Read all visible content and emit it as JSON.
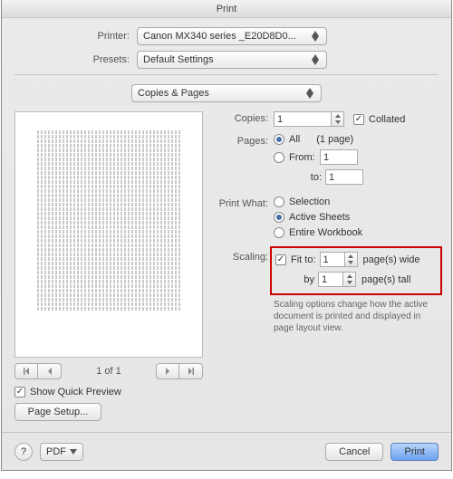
{
  "title": "Print",
  "printer": {
    "label": "Printer:",
    "value": "Canon MX340 series _E20D8D0..."
  },
  "presets": {
    "label": "Presets:",
    "value": "Default Settings"
  },
  "section": "Copies & Pages",
  "copies": {
    "label": "Copies:",
    "value": "1",
    "collated_label": "Collated",
    "collated": true
  },
  "pages": {
    "label": "Pages:",
    "all_label": "All",
    "page_count_label": "(1 page)",
    "from_label": "From:",
    "to_label": "to:",
    "from_value": "1",
    "to_value": "1",
    "selected": "all"
  },
  "print_what": {
    "label": "Print What:",
    "selection": "Selection",
    "active": "Active Sheets",
    "entire": "Entire Workbook",
    "selected": "active"
  },
  "scaling": {
    "label": "Scaling:",
    "fit_label": "Fit to:",
    "wide_value": "1",
    "wide_label": "page(s) wide",
    "by_label": "by",
    "tall_value": "1",
    "tall_label": "page(s) tall",
    "fit_checked": true,
    "help": "Scaling options change how the active document is printed and displayed in page layout view."
  },
  "preview": {
    "page_label": "1 of 1"
  },
  "quick_preview": {
    "label": "Show Quick Preview",
    "checked": true
  },
  "page_setup_label": "Page Setup...",
  "footer": {
    "help": "?",
    "pdf": "PDF",
    "cancel": "Cancel",
    "print": "Print"
  }
}
